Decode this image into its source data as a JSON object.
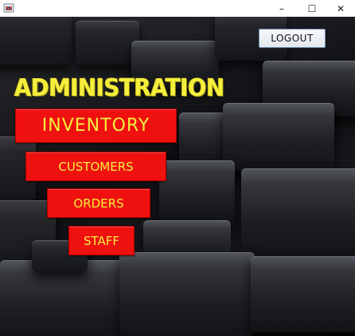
{
  "window": {
    "minimize_glyph": "–",
    "maximize_glyph": "☐",
    "close_glyph": "✕"
  },
  "header": {
    "logout_label": "LOGOUT"
  },
  "main": {
    "title": "ADMINISTRATION",
    "buttons": {
      "inventory": "INVENTORY",
      "customers": "CUSTOMERS",
      "orders": "ORDERS",
      "staff": "STAFF"
    }
  },
  "colors": {
    "title_yellow": "#f4ee3c",
    "button_red": "#ef1010",
    "button_text_yellow": "#f4ee3c"
  }
}
